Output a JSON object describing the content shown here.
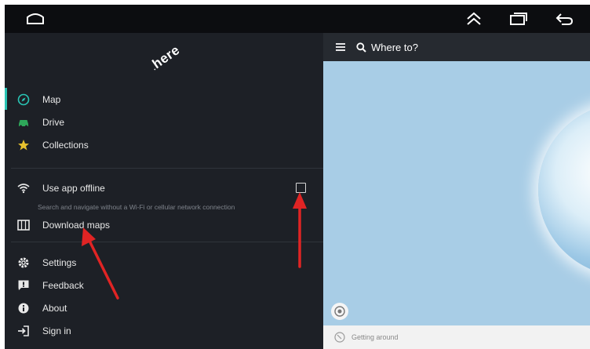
{
  "sidebar": {
    "logo": "here",
    "nav": [
      {
        "label": "Map",
        "icon": "compass-icon"
      },
      {
        "label": "Drive",
        "icon": "car-icon"
      },
      {
        "label": "Collections",
        "icon": "star-icon"
      }
    ],
    "offline": {
      "label": "Use app offline",
      "description": "Search and navigate without a Wi-Fi or cellular network connection",
      "checked": false
    },
    "download_maps": "Download maps",
    "bottom": [
      {
        "label": "Settings",
        "icon": "gear-icon"
      },
      {
        "label": "Feedback",
        "icon": "feedback-icon"
      },
      {
        "label": "About",
        "icon": "info-icon"
      },
      {
        "label": "Sign in",
        "icon": "sign-in-icon"
      }
    ]
  },
  "map": {
    "search_placeholder": "Where to?",
    "status": "Getting around"
  },
  "colors": {
    "accent": "#29c4b4",
    "sidebar_bg": "#1d2026",
    "map_water": "#a8cde6",
    "annotation_arrow": "#e02424"
  }
}
